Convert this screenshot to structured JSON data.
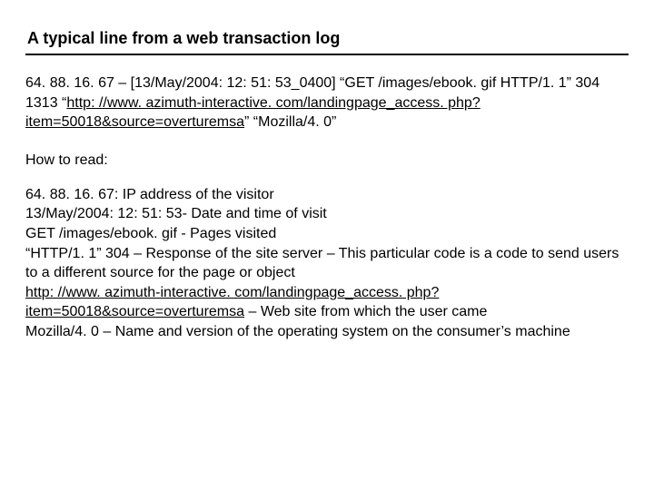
{
  "title": "A typical line from a web transaction log",
  "sample": {
    "pre_link": " 64. 88. 16. 67 – [13/May/2004: 12: 51: 53_0400] “GET /images/ebook. gif HTTP/1. 1” 304 1313 “",
    "link": "http: //www. azimuth-interactive. com/landingpage_access. php? item=50018&source=overturemsa",
    "post_link": "” “Mozilla/4. 0”"
  },
  "howto": " How to read:",
  "reading": {
    "ip": " 64. 88. 16. 67: IP address of the visitor",
    "date": " 13/May/2004: 12: 51: 53-     Date and time of visit",
    "get": " GET /images/ebook. gif      - Pages visited",
    "resp": " “HTTP/1. 1” 304 – Response of the site server – This particular code is a code to send users to a different source for the page or object",
    "ref_link": "http: //www. azimuth-interactive. com/landingpage_access. php? item=50018&source=overturemsa",
    "ref_after": " – Web site from which the user came",
    "ua": " Mozilla/4. 0 – Name and version of the operating system on the consumer’s machine"
  }
}
